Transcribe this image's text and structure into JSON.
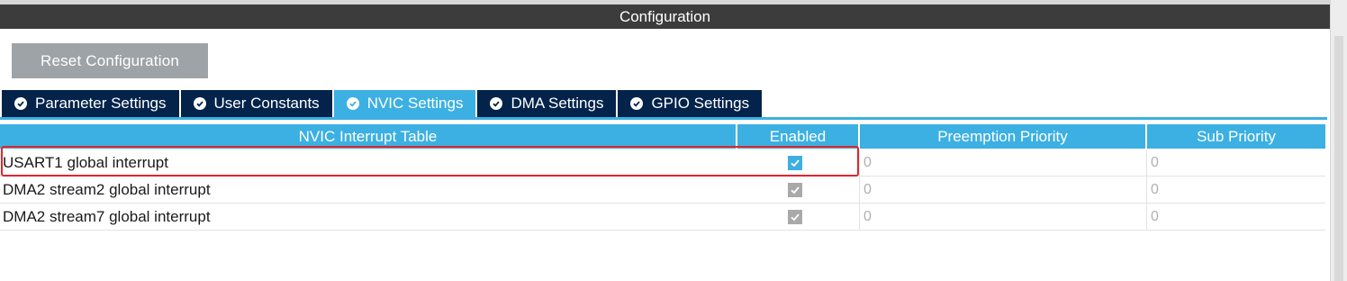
{
  "title": "Configuration",
  "reset_button": "Reset Configuration",
  "tabs": [
    {
      "label": "Parameter Settings",
      "active": false
    },
    {
      "label": "User Constants",
      "active": false
    },
    {
      "label": "NVIC Settings",
      "active": true
    },
    {
      "label": "DMA Settings",
      "active": false
    },
    {
      "label": "GPIO Settings",
      "active": false
    }
  ],
  "table": {
    "headers": [
      "NVIC Interrupt Table",
      "Enabled",
      "Preemption Priority",
      "Sub Priority"
    ],
    "rows": [
      {
        "name": "USART1 global interrupt",
        "enabled": true,
        "editable": true,
        "preemption": "0",
        "sub": "0"
      },
      {
        "name": "DMA2 stream2 global interrupt",
        "enabled": true,
        "editable": false,
        "preemption": "0",
        "sub": "0"
      },
      {
        "name": "DMA2 stream7 global interrupt",
        "enabled": true,
        "editable": false,
        "preemption": "0",
        "sub": "0"
      }
    ]
  },
  "colors": {
    "title_bar": "#3c3c3c",
    "tab_inactive": "#03234b",
    "tab_active": "#3cb0e2",
    "header": "#3cb0e2",
    "highlight": "#e0262b"
  }
}
